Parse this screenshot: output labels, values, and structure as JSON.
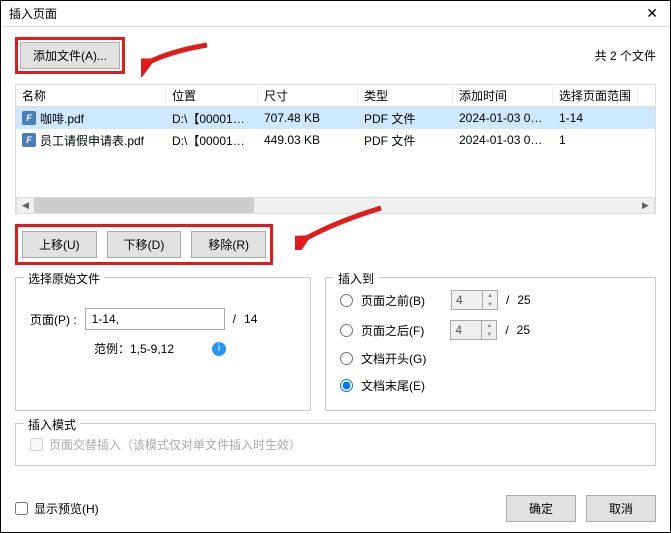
{
  "title": "插入页面",
  "add_file_label": "添加文件(A)...",
  "file_count": "共 2 个文件",
  "columns": {
    "name": "名称",
    "loc": "位置",
    "size": "尺寸",
    "type": "类型",
    "time": "添加时间",
    "range": "选择页面范围"
  },
  "rows": [
    {
      "name": "咖啡.pdf",
      "loc": "D:\\【00001】...",
      "size": "707.48 KB",
      "type": "PDF 文件",
      "time": "2024-01-03 01:...",
      "range": "1-14",
      "selected": true
    },
    {
      "name": "员工请假申请表.pdf",
      "loc": "D:\\【00001】...",
      "size": "449.03 KB",
      "type": "PDF 文件",
      "time": "2024-01-03 01:...",
      "range": "1",
      "selected": false
    }
  ],
  "buttons": {
    "up": "上移(U)",
    "down": "下移(D)",
    "remove": "移除(R)"
  },
  "source": {
    "legend": "选择原始文件",
    "page_label": "页面(P) :",
    "page_value": "1-14,",
    "sep": "/",
    "total": "14",
    "example": "范例：1,5-9,12"
  },
  "insert": {
    "legend": "插入到",
    "before": "页面之前(B)",
    "after": "页面之后(F)",
    "doc_start": "文档开头(G)",
    "doc_end": "文档末尾(E)",
    "num1": "4",
    "num2": "4",
    "sep": "/",
    "tot1": "25",
    "tot2": "25"
  },
  "mode": {
    "legend": "插入模式",
    "alt": "页面交替插入（该模式仅对单文件插入时生效）"
  },
  "footer": {
    "preview": "显示预览(H)",
    "ok": "确定",
    "cancel": "取消"
  }
}
